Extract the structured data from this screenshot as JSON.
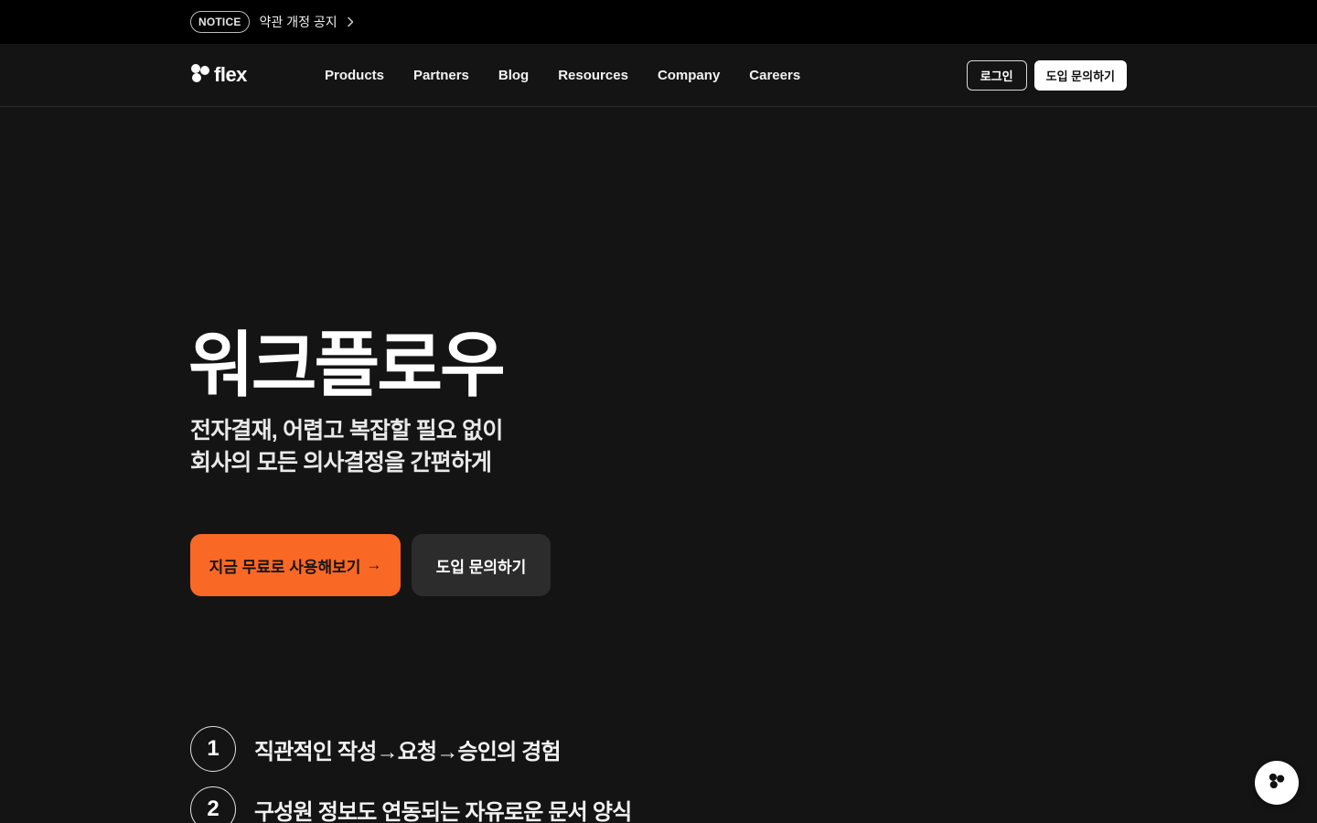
{
  "notice": {
    "badge": "NOTICE",
    "text": "약관 개정 공지"
  },
  "header": {
    "logo_text": "flex",
    "nav": [
      "Products",
      "Partners",
      "Blog",
      "Resources",
      "Company",
      "Careers"
    ],
    "login_label": "로그인",
    "contact_label": "도입 문의하기"
  },
  "hero": {
    "title": "워크플로우",
    "subtitle_lines": [
      "전자결재, 어렵고 복잡할 필요 없이",
      "회사의 모든 의사결정을 간편하게"
    ],
    "cta_primary": "지금 무료로 사용해보기",
    "cta_primary_arrow": "→",
    "cta_secondary": "도입 문의하기"
  },
  "features": [
    {
      "num": "1",
      "text": "직관적인 작성→요청→승인의 경험"
    },
    {
      "num": "2",
      "text": "구성원 정보도 연동되는 자유로운 문서 양식"
    }
  ],
  "colors": {
    "background": "#151414",
    "accent": "#fa6825",
    "secondary_button": "#2c2c2c"
  },
  "icons": {
    "notice_chevron": "chevron-right-icon",
    "logo_mark": "flex-logo-icon",
    "float": "flex-chat-icon"
  }
}
